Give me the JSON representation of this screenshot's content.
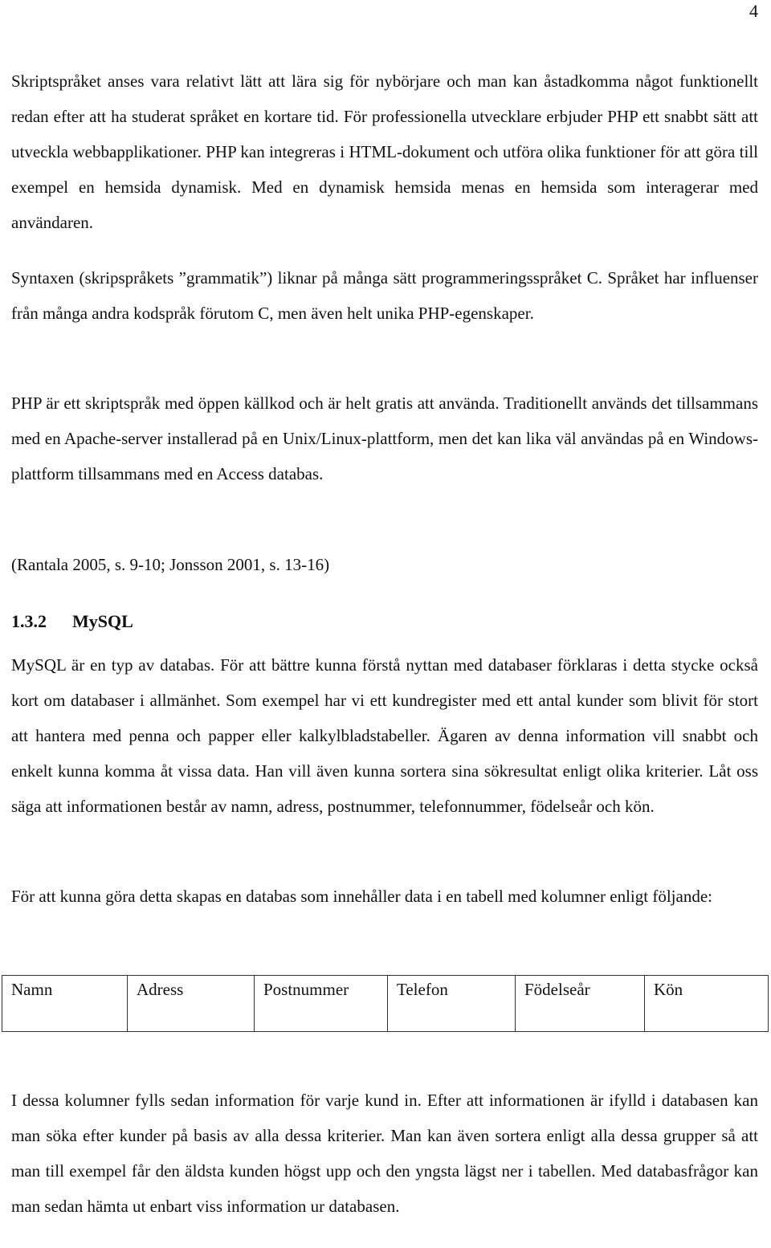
{
  "page_number": "4",
  "paragraphs": {
    "p1": "Skriptspråket anses vara relativt lätt att lära sig för nybörjare och man kan åstadkomma något funktionellt redan efter att ha studerat språket en kortare tid. För professionella utvecklare erbjuder PHP ett snabbt sätt att utveckla webbapplikationer. PHP kan integreras i HTML-dokument och utföra olika funktioner för att göra till exempel en hemsida dynamisk. Med en dynamisk hemsida menas en hemsida som interagerar med användaren.",
    "p2": "Syntaxen (skripspråkets ”grammatik”) liknar på många sätt programmeringsspråket C. Språket har influenser från många andra kodspråk förutom C, men även helt unika PHP-egenskaper.",
    "p3": "PHP är ett skriptspråk med öppen källkod och är helt gratis att använda. Traditionellt används det tillsammans med en Apache-server installerad på en Unix/Linux-plattform, men det kan lika väl användas på en Windows-plattform tillsammans med en Access databas.",
    "p4": "(Rantala 2005, s. 9-10; Jonsson 2001, s. 13-16)",
    "p5": "MySQL är en typ av databas.  För att bättre kunna förstå nyttan med databaser förklaras i detta stycke också kort om databaser i allmänhet. Som exempel har vi ett kundregister med ett antal kunder som blivit för stort att hantera med penna och papper eller kalkylbladstabeller. Ägaren av denna information vill snabbt och enkelt kunna komma åt vissa data. Han vill även kunna sortera sina sökresultat enligt olika kriterier. Låt oss säga att informationen består av namn, adress, postnummer, telefonnummer, födelseår och kön.",
    "p6": "För att kunna göra detta skapas en databas som innehåller data i en tabell med kolumner enligt följande:",
    "p7": "I dessa kolumner fylls sedan information för varje kund in. Efter att informationen är ifylld i databasen kan man söka efter kunder på basis av alla dessa kriterier.  Man kan även sortera enligt alla dessa grupper så att man till exempel får den äldsta kunden högst upp och den yngsta lägst ner i tabellen. Med databasfrågor kan man sedan hämta ut enbart viss information ur databasen."
  },
  "heading": {
    "number": "1.3.2",
    "title": "MySQL"
  },
  "table": {
    "columns": [
      "Namn",
      "Adress",
      "Postnummer",
      "Telefon",
      "Födelseår",
      "Kön"
    ]
  }
}
